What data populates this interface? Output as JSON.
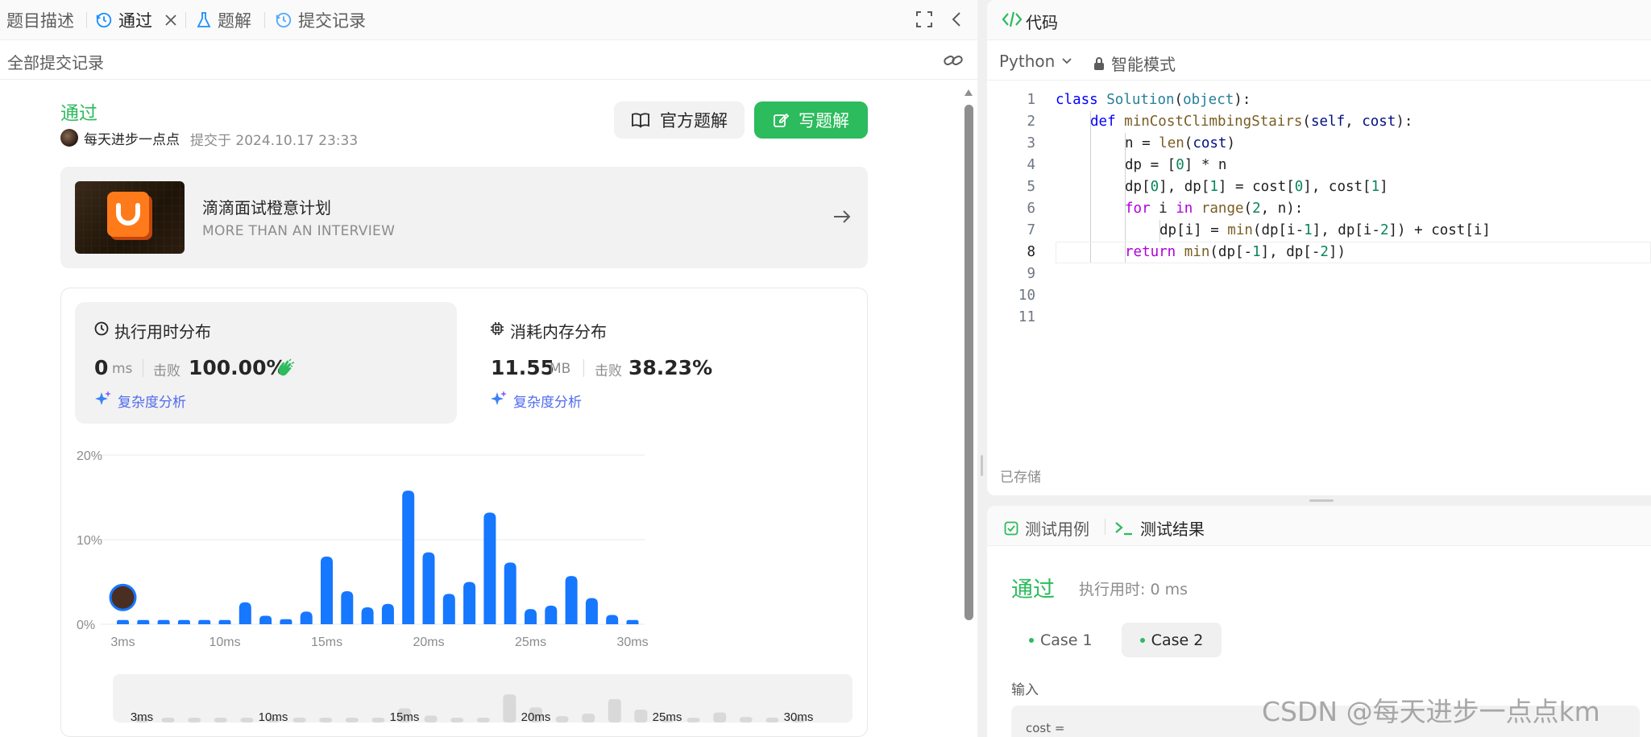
{
  "left_tabs": [
    {
      "label": "题目描述"
    },
    {
      "label": "通过"
    },
    {
      "label": "题解"
    },
    {
      "label": "提交记录"
    }
  ],
  "subbar": {
    "title": "全部提交记录"
  },
  "submission": {
    "status": "通过",
    "user": "每天进步一点点",
    "submitted_text": "提交于 2024.10.17 23:33",
    "official_solution_label": "官方题解",
    "write_solution_label": "写题解"
  },
  "banner": {
    "title": "滴滴面试橙意计划",
    "subtitle": "MORE THAN AN INTERVIEW"
  },
  "runtime": {
    "title": "执行用时分布",
    "value": "0",
    "unit": "ms",
    "beats_label": "击败",
    "beats": "100.00%",
    "analysis_label": "复杂度分析"
  },
  "memory": {
    "title": "消耗内存分布",
    "value": "11.55",
    "unit": "MB",
    "beats_label": "击败",
    "beats": "38.23%",
    "analysis_label": "复杂度分析"
  },
  "chart_data": {
    "type": "bar",
    "y_ticks": [
      "20%",
      "10%",
      "0%"
    ],
    "ylim": [
      0,
      20
    ],
    "x_ticks": [
      {
        "label": "3ms",
        "at": 3
      },
      {
        "label": "10ms",
        "at": 8
      },
      {
        "label": "15ms",
        "at": 13
      },
      {
        "label": "20ms",
        "at": 18
      },
      {
        "label": "25ms",
        "at": 23
      },
      {
        "label": "30ms",
        "at": 28
      }
    ],
    "categories": [
      3,
      4,
      5,
      6,
      7,
      8,
      9,
      10,
      11,
      12,
      13,
      14,
      15,
      16,
      17,
      18,
      19,
      20,
      21,
      22,
      23,
      24,
      25,
      26,
      27,
      28
    ],
    "values": [
      0.5,
      0.5,
      0.5,
      0.5,
      0.5,
      0.5,
      2.6,
      1.0,
      0.6,
      1.5,
      8.0,
      3.9,
      2.0,
      2.4,
      15.8,
      8.5,
      3.6,
      5.0,
      13.2,
      7.3,
      1.8,
      2.2,
      5.7,
      3.1,
      1.1,
      0.5
    ],
    "highlight_index": 0,
    "bar_color": "#1677ff"
  },
  "minimap": {
    "ticks": [
      "3ms",
      "10ms",
      "15ms",
      "20ms",
      "25ms",
      "30ms"
    ]
  },
  "code_header": {
    "title": "代码"
  },
  "code_toolbar": {
    "language": "Python",
    "mode": "智能模式"
  },
  "code_lines": [
    {
      "n": "1"
    },
    {
      "n": "2"
    },
    {
      "n": "3"
    },
    {
      "n": "4"
    },
    {
      "n": "5"
    },
    {
      "n": "6"
    },
    {
      "n": "7"
    },
    {
      "n": "8"
    },
    {
      "n": "9"
    },
    {
      "n": "10"
    },
    {
      "n": "11"
    }
  ],
  "code_text": [
    "class Solution(object):",
    "def minCostClimbingStairs(self, cost):",
    "n = len(cost)",
    "dp = [0] * n",
    "dp[0], dp[1] = cost[0], cost[1]",
    "for i in range(2, n):",
    "dp[i] = min(dp[i-1], dp[i-2]) + cost[i]",
    "return min(dp[-1], dp[-2])"
  ],
  "saved_label": "已存储",
  "console_tabs": [
    {
      "label": "测试用例"
    },
    {
      "label": "测试结果"
    }
  ],
  "result": {
    "status": "通过",
    "runtime_text": "执行用时: 0 ms",
    "cases": [
      {
        "label": "Case 1"
      },
      {
        "label": "Case 2"
      }
    ],
    "input_label": "输入",
    "input_line": "cost ="
  },
  "watermark": "CSDN @每天进步一点点km",
  "colors": {
    "accent_green": "#2cbb5d",
    "accent_blue": "#1677ff",
    "icon_blue": "#1a90ff"
  }
}
